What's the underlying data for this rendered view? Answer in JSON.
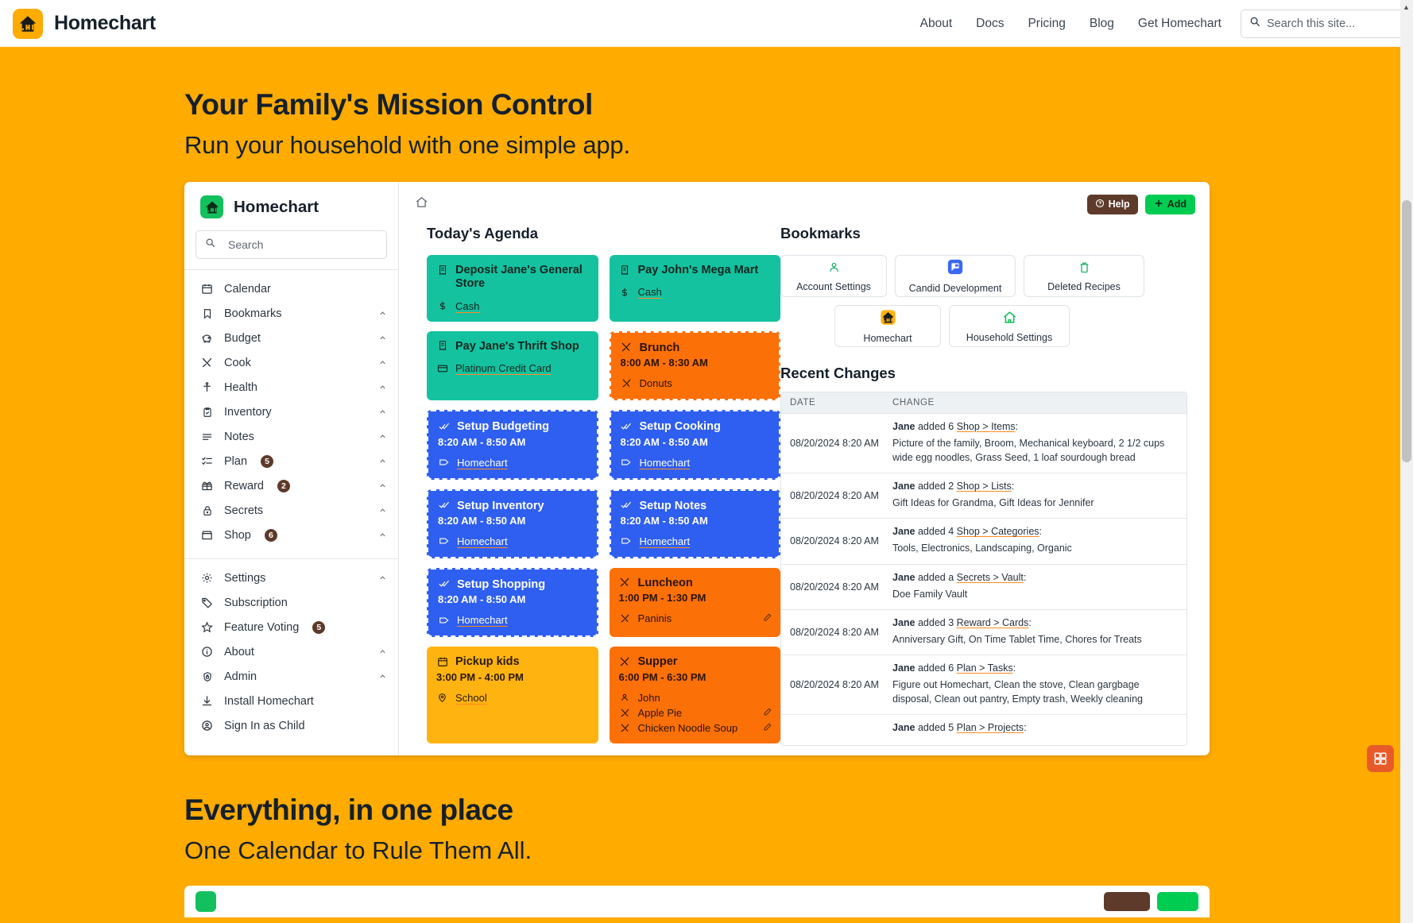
{
  "site": {
    "brand": "Homechart",
    "nav": [
      {
        "label": "About"
      },
      {
        "label": "Docs"
      },
      {
        "label": "Pricing"
      },
      {
        "label": "Blog"
      },
      {
        "label": "Get Homechart"
      }
    ],
    "search_placeholder": "Search this site..."
  },
  "hero": {
    "title": "Your Family's Mission Control",
    "subtitle": "Run your household with one simple app."
  },
  "hero2": {
    "title": "Everything, in one place",
    "subtitle": "One Calendar to Rule Them All."
  },
  "app": {
    "sidebar": {
      "title": "Homechart",
      "search_placeholder": "Search",
      "items": [
        {
          "label": "Calendar",
          "icon": "calendar-icon",
          "badge": "",
          "chevron": false
        },
        {
          "label": "Bookmarks",
          "icon": "bookmark-icon",
          "badge": "",
          "chevron": true
        },
        {
          "label": "Budget",
          "icon": "piggy-bank-icon",
          "badge": "",
          "chevron": true
        },
        {
          "label": "Cook",
          "icon": "utensils-icon",
          "badge": "",
          "chevron": true
        },
        {
          "label": "Health",
          "icon": "person-icon",
          "badge": "",
          "chevron": true
        },
        {
          "label": "Inventory",
          "icon": "clipboard-check-icon",
          "badge": "",
          "chevron": true
        },
        {
          "label": "Notes",
          "icon": "notes-icon",
          "badge": "",
          "chevron": true
        },
        {
          "label": "Plan",
          "icon": "tasks-icon",
          "badge": "5",
          "chevron": true
        },
        {
          "label": "Reward",
          "icon": "gift-icon",
          "badge": "2",
          "chevron": true
        },
        {
          "label": "Secrets",
          "icon": "lock-icon",
          "badge": "",
          "chevron": true
        },
        {
          "label": "Shop",
          "icon": "store-icon",
          "badge": "6",
          "chevron": true
        }
      ],
      "items2": [
        {
          "label": "Settings",
          "icon": "gear-icon",
          "badge": "",
          "chevron": true
        },
        {
          "label": "Subscription",
          "icon": "tag-icon",
          "badge": "",
          "chevron": false
        },
        {
          "label": "Feature Voting",
          "icon": "star-icon",
          "badge": "5",
          "chevron": false
        },
        {
          "label": "About",
          "icon": "info-icon",
          "badge": "",
          "chevron": true
        },
        {
          "label": "Admin",
          "icon": "shield-lock-icon",
          "badge": "",
          "chevron": true
        },
        {
          "label": "Install Homechart",
          "icon": "download-icon",
          "badge": "",
          "chevron": false
        },
        {
          "label": "Sign In as Child",
          "icon": "user-circle-icon",
          "badge": "",
          "chevron": false
        }
      ]
    },
    "toolbar": {
      "home_icon": "home-icon",
      "help_label": "Help",
      "add_label": "Add"
    },
    "agenda": {
      "title": "Today's Agenda",
      "cards": [
        {
          "style": "teal",
          "icon": "receipt-icon",
          "title": "Deposit Jane's General Store",
          "time": "",
          "meta_icon": "dollar-icon",
          "meta": "Cash",
          "pencil": false
        },
        {
          "style": "teal",
          "icon": "receipt-icon",
          "title": "Pay John's Mega Mart",
          "time": "",
          "meta_icon": "dollar-icon",
          "meta": "Cash",
          "pencil": false
        },
        {
          "style": "teal",
          "icon": "receipt-icon",
          "title": "Pay Jane's Thrift Shop",
          "time": "",
          "meta_icon": "card-icon",
          "meta": "Platinum Credit Card",
          "pencil": false
        },
        {
          "style": "orange",
          "icon": "utensils-icon",
          "title": "Brunch",
          "time": "8:00 AM - 8:30 AM",
          "meta_icon": "utensils-icon",
          "meta": "Donuts",
          "pencil": false
        },
        {
          "style": "blue",
          "icon": "double-check-icon",
          "title": "Setup Budgeting",
          "time": "8:20 AM - 8:50 AM",
          "meta_icon": "tag-icon",
          "meta": "Homechart",
          "pencil": false
        },
        {
          "style": "blue",
          "icon": "double-check-icon",
          "title": "Setup Cooking",
          "time": "8:20 AM - 8:50 AM",
          "meta_icon": "tag-icon",
          "meta": "Homechart",
          "pencil": false
        },
        {
          "style": "blue",
          "icon": "double-check-icon",
          "title": "Setup Inventory",
          "time": "8:20 AM - 8:50 AM",
          "meta_icon": "tag-icon",
          "meta": "Homechart",
          "pencil": false
        },
        {
          "style": "blue",
          "icon": "double-check-icon",
          "title": "Setup Notes",
          "time": "8:20 AM - 8:50 AM",
          "meta_icon": "tag-icon",
          "meta": "Homechart",
          "pencil": false
        },
        {
          "style": "blue",
          "icon": "double-check-icon",
          "title": "Setup Shopping",
          "time": "8:20 AM - 8:50 AM",
          "meta_icon": "tag-icon",
          "meta": "Homechart",
          "pencil": false
        },
        {
          "style": "orange-solid",
          "icon": "utensils-icon",
          "title": "Luncheon",
          "time": "1:00 PM - 1:30 PM",
          "meta_icon": "utensils-icon",
          "meta": "Paninis",
          "pencil": true
        },
        {
          "style": "amber",
          "icon": "calendar-icon",
          "title": "Pickup kids",
          "time": "3:00 PM - 4:00 PM",
          "meta_icon": "location-icon",
          "meta": "School",
          "pencil": false
        },
        {
          "style": "orange-solid",
          "icon": "utensils-icon",
          "title": "Supper",
          "time": "6:00 PM - 6:30 PM",
          "meta_icon": "person-icon",
          "meta": "John",
          "meta2_icon": "utensils-icon",
          "meta2": "Apple Pie",
          "meta3_icon": "utensils-icon",
          "meta3": "Chicken Noodle Soup",
          "pencil": true
        }
      ]
    },
    "bookmarks": {
      "title": "Bookmarks",
      "items": [
        {
          "label": "Account Settings",
          "icon": "person-green-icon"
        },
        {
          "label": "Candid Development",
          "icon": "blue-chat-icon"
        },
        {
          "label": "Deleted Recipes",
          "icon": "trash-green-icon"
        },
        {
          "label": "Homechart",
          "icon": "homechart-orange-icon"
        },
        {
          "label": "Household Settings",
          "icon": "house-green-icon"
        }
      ]
    },
    "recent_changes": {
      "title": "Recent Changes",
      "columns": [
        "DATE",
        "CHANGE"
      ],
      "rows": [
        {
          "date": "08/20/2024 8:20 AM",
          "actor": "Jane",
          "action": " added 6 ",
          "link": "Shop > Items",
          "suffix": ":",
          "detail": "Picture of the family, Broom, Mechanical keyboard, 2 1/2 cups wide egg noodles, Grass Seed, 1 loaf sourdough bread"
        },
        {
          "date": "08/20/2024 8:20 AM",
          "actor": "Jane",
          "action": " added 2 ",
          "link": "Shop > Lists",
          "suffix": ":",
          "detail": "Gift Ideas for Grandma, Gift Ideas for Jennifer"
        },
        {
          "date": "08/20/2024 8:20 AM",
          "actor": "Jane",
          "action": " added 4 ",
          "link": "Shop > Categories",
          "suffix": ":",
          "detail": "Tools, Electronics, Landscaping, Organic"
        },
        {
          "date": "08/20/2024 8:20 AM",
          "actor": "Jane",
          "action": " added a ",
          "link": "Secrets > Vault",
          "suffix": ":",
          "detail": "Doe Family Vault"
        },
        {
          "date": "08/20/2024 8:20 AM",
          "actor": "Jane",
          "action": " added 3 ",
          "link": "Reward > Cards",
          "suffix": ":",
          "detail": "Anniversary Gift, On Time Tablet Time, Chores for Treats"
        },
        {
          "date": "08/20/2024 8:20 AM",
          "actor": "Jane",
          "action": " added 6 ",
          "link": "Plan > Tasks",
          "suffix": ":",
          "detail": "Figure out Homechart, Clean the stove, Clean gargbage disposal, Clean out pantry, Empty trash, Weekly cleaning"
        },
        {
          "date": "",
          "actor": "Jane",
          "action": " added 5 ",
          "link": "Plan > Projects",
          "suffix": ":",
          "detail": ""
        }
      ]
    }
  },
  "colors": {
    "page_bg": "#ffab00",
    "teal": "#14c2a0",
    "blue": "#2f5ff0",
    "orange": "#fc7008",
    "amber": "#ffb310",
    "green": "#00cc52",
    "brown": "#5e3a2b"
  }
}
